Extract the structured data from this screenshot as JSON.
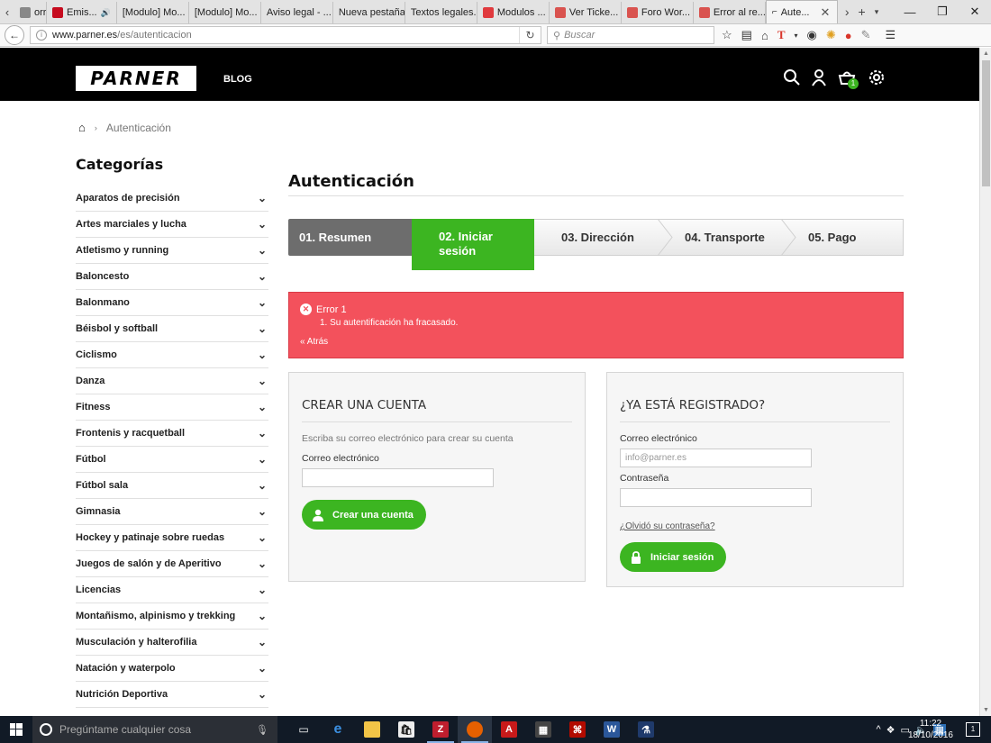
{
  "browser": {
    "tabs": [
      {
        "label": "orr...",
        "fav": "#888"
      },
      {
        "label": "Emis...",
        "fav": "#c60b1e",
        "audio": true
      },
      {
        "label": "[Modulo] Mo...",
        "fav": ""
      },
      {
        "label": "[Modulo] Mo...",
        "fav": ""
      },
      {
        "label": "Aviso legal - ...",
        "fav": ""
      },
      {
        "label": "Nueva pestaña",
        "fav": ""
      },
      {
        "label": "Textos legales...",
        "fav": ""
      },
      {
        "label": "Modulos ...",
        "fav": "#e03a3e"
      },
      {
        "label": "Ver Ticke...",
        "fav": "#d9534f"
      },
      {
        "label": "Foro Wor...",
        "fav": "#d9534f"
      },
      {
        "label": "Error al re...",
        "fav": "#d9534f"
      }
    ],
    "active_tab": "Aute...",
    "url_domain": "www.parner.es",
    "url_path": "/es/autenticacion",
    "search_placeholder": "Buscar"
  },
  "header": {
    "logo_text": "PARNER",
    "blog_label": "BLOG",
    "cart_count": "1"
  },
  "breadcrumb": {
    "current": "Autenticación"
  },
  "sidebar": {
    "title": "Categorías",
    "categories": [
      "Aparatos de precisión",
      "Artes marciales y lucha",
      "Atletismo y running",
      "Baloncesto",
      "Balonmano",
      "Béisbol y softball",
      "Ciclismo",
      "Danza",
      "Fitness",
      "Frontenis y racquetball",
      "Fútbol",
      "Fútbol sala",
      "Gimnasia",
      "Hockey y patinaje sobre ruedas",
      "Juegos de salón y de Aperitivo",
      "Licencias",
      "Montañismo, alpinismo y trekking",
      "Musculación y halterofilia",
      "Natación y waterpolo",
      "Nutrición Deportiva"
    ]
  },
  "main": {
    "title": "Autenticación",
    "steps": [
      "01. Resumen",
      "02. Iniciar sesión",
      "03. Dirección",
      "04. Transporte",
      "05. Pago"
    ],
    "alert": {
      "title": "Error 1",
      "item": "1. Su autentificación ha fracasado.",
      "back": "« Atrás"
    },
    "create": {
      "title": "CREAR UNA CUENTA",
      "desc": "Escriba su correo electrónico para crear su cuenta",
      "email_label": "Correo electrónico",
      "email_value": "",
      "button": "Crear una cuenta"
    },
    "login": {
      "title": "¿YA ESTÁ REGISTRADO?",
      "email_label": "Correo electrónico",
      "email_value": "info@parner.es",
      "password_label": "Contraseña",
      "forgot": "¿Olvidó su contraseña?",
      "button": "Iniciar sesión"
    }
  },
  "taskbar": {
    "search_placeholder": "Pregúntame cualquier cosa",
    "time": "11:22",
    "date": "18/10/2016",
    "notif_count": "1"
  }
}
